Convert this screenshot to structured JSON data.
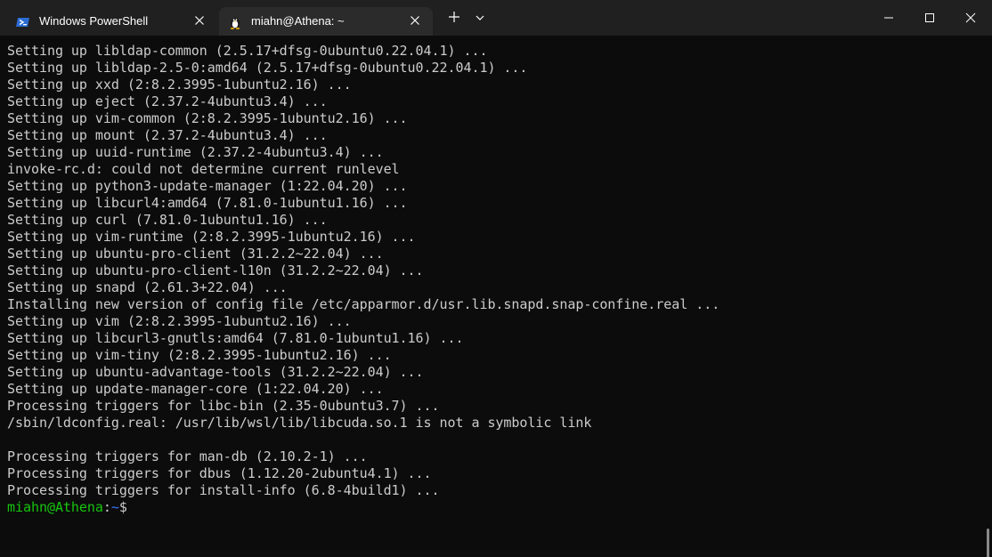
{
  "tabs": [
    {
      "label": "Windows PowerShell",
      "icon": "powershell-icon",
      "active": false
    },
    {
      "label": "miahn@Athena: ~",
      "icon": "linux-penguin-icon",
      "active": true
    }
  ],
  "new_tab_icon": "plus-icon",
  "dropdown_icon": "chevron-down-icon",
  "window_controls": [
    "minimize-icon",
    "maximize-icon",
    "close-icon"
  ],
  "terminal": {
    "lines": [
      "Setting up libldap-common (2.5.17+dfsg-0ubuntu0.22.04.1) ...",
      "Setting up libldap-2.5-0:amd64 (2.5.17+dfsg-0ubuntu0.22.04.1) ...",
      "Setting up xxd (2:8.2.3995-1ubuntu2.16) ...",
      "Setting up eject (2.37.2-4ubuntu3.4) ...",
      "Setting up vim-common (2:8.2.3995-1ubuntu2.16) ...",
      "Setting up mount (2.37.2-4ubuntu3.4) ...",
      "Setting up uuid-runtime (2.37.2-4ubuntu3.4) ...",
      "invoke-rc.d: could not determine current runlevel",
      "Setting up python3-update-manager (1:22.04.20) ...",
      "Setting up libcurl4:amd64 (7.81.0-1ubuntu1.16) ...",
      "Setting up curl (7.81.0-1ubuntu1.16) ...",
      "Setting up vim-runtime (2:8.2.3995-1ubuntu2.16) ...",
      "Setting up ubuntu-pro-client (31.2.2~22.04) ...",
      "Setting up ubuntu-pro-client-l10n (31.2.2~22.04) ...",
      "Setting up snapd (2.61.3+22.04) ...",
      "Installing new version of config file /etc/apparmor.d/usr.lib.snapd.snap-confine.real ...",
      "Setting up vim (2:8.2.3995-1ubuntu2.16) ...",
      "Setting up libcurl3-gnutls:amd64 (7.81.0-1ubuntu1.16) ...",
      "Setting up vim-tiny (2:8.2.3995-1ubuntu2.16) ...",
      "Setting up ubuntu-advantage-tools (31.2.2~22.04) ...",
      "Setting up update-manager-core (1:22.04.20) ...",
      "Processing triggers for libc-bin (2.35-0ubuntu3.7) ...",
      "/sbin/ldconfig.real: /usr/lib/wsl/lib/libcuda.so.1 is not a symbolic link",
      "",
      "Processing triggers for man-db (2.10.2-1) ...",
      "Processing triggers for dbus (1.12.20-2ubuntu4.1) ...",
      "Processing triggers for install-info (6.8-4build1) ..."
    ],
    "prompt": {
      "user_host": "miahn@Athena",
      "separator": ":",
      "path": "~",
      "symbol": "$"
    }
  },
  "colors": {
    "titlebar": "#202020",
    "active_tab": "#2b2b2b",
    "terminal_bg": "#0c0c0c",
    "text": "#cccccc",
    "prompt_user": "#16c60c",
    "prompt_path": "#3b78ff"
  }
}
